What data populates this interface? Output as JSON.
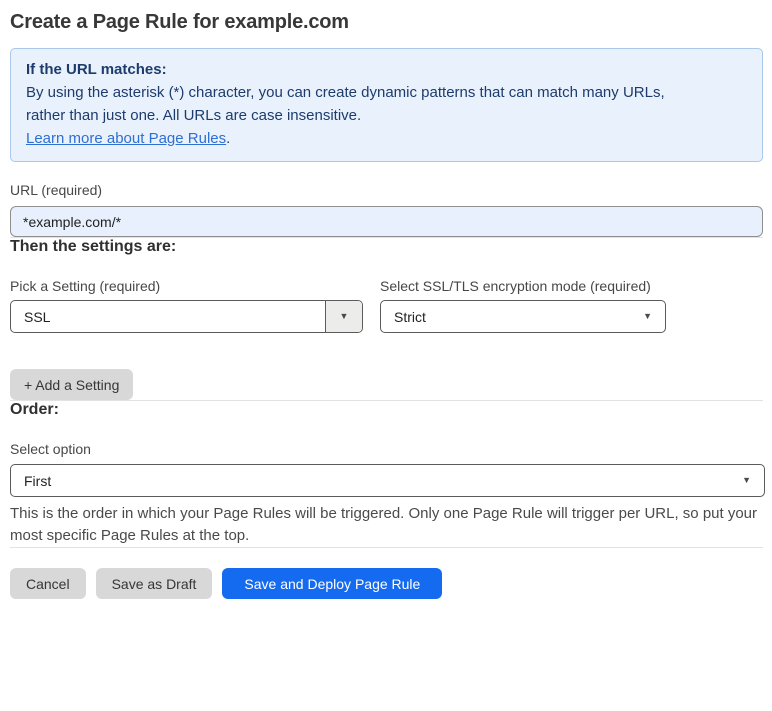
{
  "page": {
    "title": "Create a Page Rule for example.com"
  },
  "icons": {
    "dropdown_arrow": "▼"
  },
  "colors": {
    "info_box_bg": "#e9f2fc",
    "info_box_border": "#a9c8ea",
    "info_text": "#1d3b6d",
    "link": "#2e6fd2",
    "url_input_bg": "#e8f0fe",
    "primary_button_bg": "#156bf0",
    "gray_button_bg": "#d8d8d8"
  },
  "info_box": {
    "heading": "If the URL matches:",
    "body_lines": [
      "By using the asterisk (*) character, you can create dynamic patterns that can match many URLs,",
      "rather than just one. All URLs are case insensitive."
    ],
    "link_label": "Learn more about Page Rules",
    "link_suffix": "."
  },
  "url_field": {
    "label": "URL (required)",
    "value": "*example.com/*"
  },
  "settings_section": {
    "heading": "Then the settings are:",
    "setting_picker": {
      "label": "Pick a Setting (required)",
      "selected": "SSL"
    },
    "ssl_mode_picker": {
      "label": "Select SSL/TLS encryption mode (required)",
      "selected": "Strict"
    },
    "add_setting_label": "+ Add a Setting"
  },
  "order_section": {
    "heading": "Order:",
    "select_label": "Select option",
    "selected": "First",
    "help_lines": [
      "This is the order in which your Page Rules will be triggered. Only one Page Rule will trigger per URL, so put your",
      "most specific Page Rules at the top."
    ]
  },
  "footer": {
    "cancel_label": "Cancel",
    "save_draft_label": "Save as Draft",
    "save_deploy_label": "Save and Deploy Page Rule"
  }
}
